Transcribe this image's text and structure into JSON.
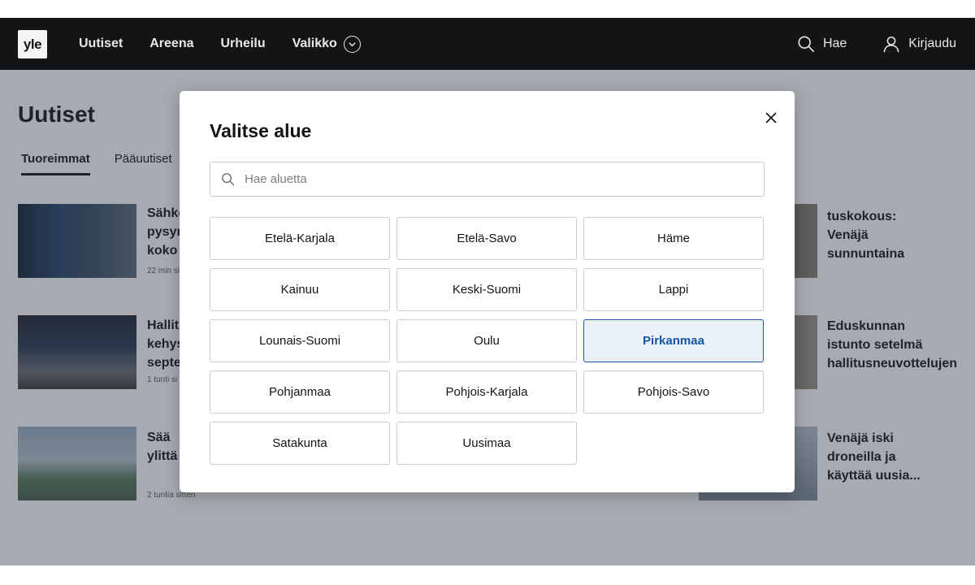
{
  "header": {
    "logo": "yle",
    "nav": [
      "Uutiset",
      "Areena",
      "Urheilu",
      "Valikko"
    ],
    "search_label": "Hae",
    "login_label": "Kirjaudu"
  },
  "page": {
    "title": "Uutiset",
    "tabs": [
      "Tuoreimmat",
      "Pääuutiset"
    ],
    "articles_left": [
      {
        "lines": [
          "Sähkö",
          "pysym",
          "koko"
        ],
        "time": "22 min si"
      },
      {
        "lines": [
          "Hallit",
          "kehys",
          "septe"
        ],
        "time": "1 tunti si"
      },
      {
        "lines": [
          "Sää",
          "ylittä"
        ],
        "time": "2 tuntia sitten"
      }
    ],
    "articles_right": [
      {
        "lines": [
          "tuskokous:",
          "Venäjä",
          "sunnuntaina"
        ]
      },
      {
        "lines": [
          "Eduskunnan",
          "istunto setelmä",
          "hallitusneuvottelujen"
        ]
      },
      {
        "lines": [
          "Venäjä iski",
          "droneilla ja",
          "käyttää uusia..."
        ]
      }
    ]
  },
  "modal": {
    "title": "Valitse alue",
    "search_placeholder": "Hae aluetta",
    "regions": [
      "Etelä-Karjala",
      "Etelä-Savo",
      "Häme",
      "Kainuu",
      "Keski-Suomi",
      "Lappi",
      "Lounais-Suomi",
      "Oulu",
      "Pirkanmaa",
      "Pohjanmaa",
      "Pohjois-Karjala",
      "Pohjois-Savo",
      "Satakunta",
      "Uusimaa"
    ],
    "selected_region": "Pirkanmaa"
  },
  "colors": {
    "header_bg": "#131415",
    "selected_border": "#1d5aa8",
    "selected_bg": "#eaf1fa",
    "selected_text": "#14559e"
  },
  "icons": {
    "search": "search-icon",
    "user": "user-icon",
    "close": "close-icon",
    "menu_chevron": "chevron-down-icon"
  }
}
